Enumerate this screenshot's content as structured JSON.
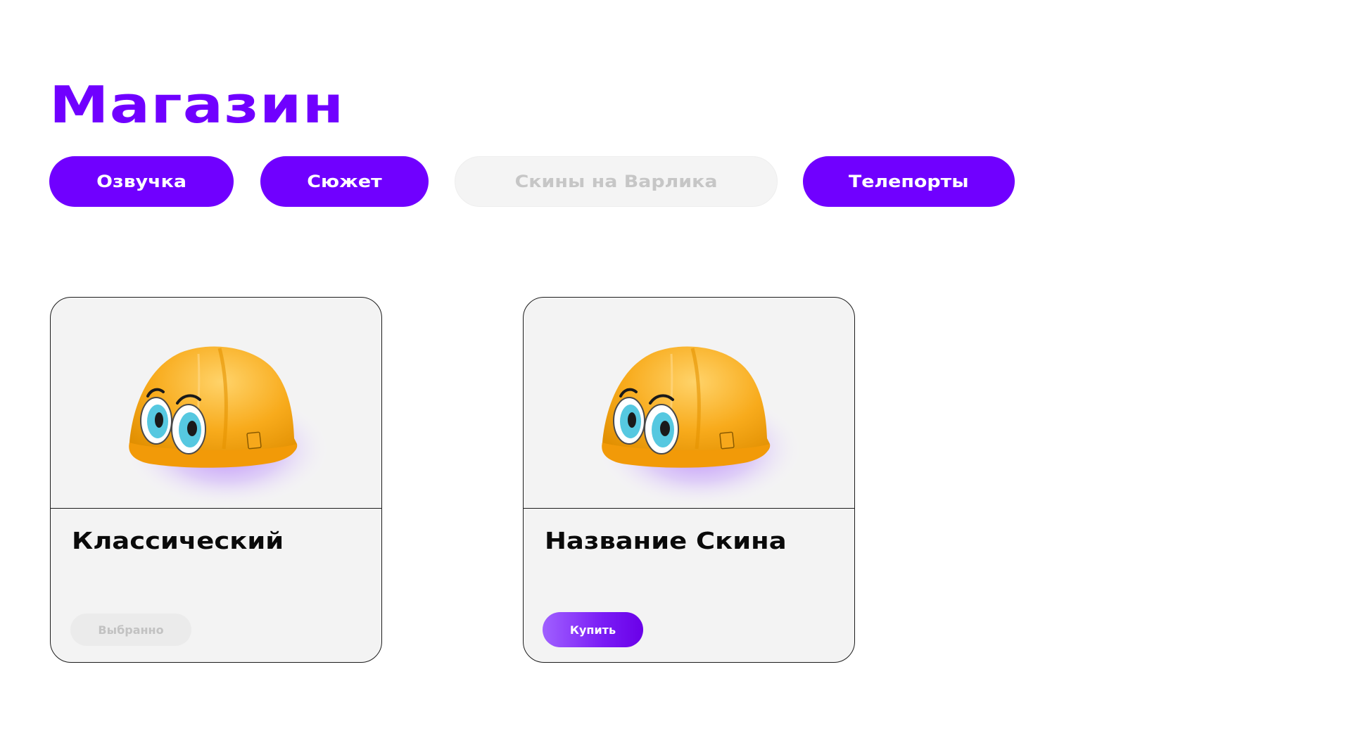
{
  "page": {
    "title": "Магазин"
  },
  "tabs": [
    {
      "label": "Озвучка",
      "active": true
    },
    {
      "label": "Сюжет",
      "active": true
    },
    {
      "label": "Скины на Варлика",
      "active": false
    },
    {
      "label": "Телепорты",
      "active": true
    }
  ],
  "cards": [
    {
      "name": "Классический",
      "button_label": "Выбранно",
      "button_state": "selected",
      "image": "helmet-with-eyes-icon"
    },
    {
      "name": "Название Скина",
      "button_label": "Купить",
      "button_state": "buy",
      "image": "helmet-with-eyes-icon"
    }
  ],
  "colors": {
    "accent": "#7000ff",
    "helmet": "#f7a81b",
    "glow": "#a45cff",
    "eye_iris": "#56c8e0"
  }
}
